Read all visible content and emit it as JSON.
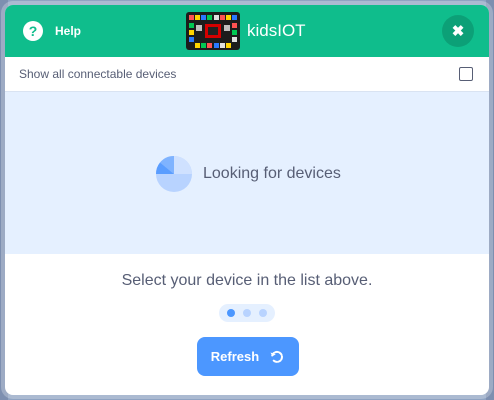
{
  "header": {
    "help_label": "Help",
    "help_icon": "question-circle-icon",
    "title": "kidsIOT",
    "board_image": "circuit-board-image",
    "close_icon": "close-icon",
    "close_glyph": "✖"
  },
  "options": {
    "show_all_label": "Show all connectable devices",
    "show_all_checked": false
  },
  "scan": {
    "status_text": "Looking for devices",
    "spinner_icon": "radar-spinner-icon"
  },
  "instruction": "Select your device in the list above.",
  "progress": {
    "steps": 3,
    "current_step": 1
  },
  "refresh": {
    "label": "Refresh",
    "icon": "refresh-icon"
  },
  "colors": {
    "header_bg": "#0fbd8c",
    "scan_bg": "#e5f0ff",
    "button_bg": "#4c97ff",
    "text": "#575e75",
    "dot_active": "#4c97ff",
    "dot_inactive": "#b8d3ff"
  }
}
